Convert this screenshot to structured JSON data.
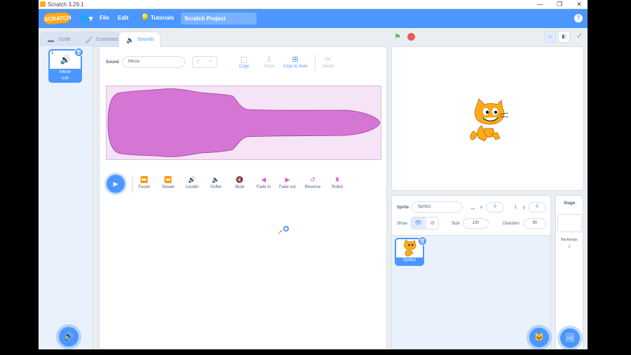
{
  "window": {
    "title": "Scratch 3.29.1",
    "controls": [
      "—",
      "❐",
      "✕"
    ]
  },
  "menubar": {
    "logo": "SCRATCH",
    "language_icon": "globe-icon",
    "file": "File",
    "edit": "Edit",
    "tutorials": "Tutorials",
    "project_title": "Scratch Project",
    "help": "?"
  },
  "tabs": [
    {
      "label": "Code",
      "icon": "code-icon"
    },
    {
      "label": "Costumes",
      "icon": "brush-icon"
    },
    {
      "label": "Sounds",
      "icon": "speaker-icon"
    }
  ],
  "soundlist": {
    "items": [
      {
        "number": "1",
        "name": "Meow",
        "duration": "0.85"
      }
    ]
  },
  "editor": {
    "sound_label": "Sound",
    "sound_name": "Meow",
    "tools": [
      {
        "label": "Copy",
        "enabled": true
      },
      {
        "label": "Paste",
        "enabled": false
      },
      {
        "label": "Copy to New",
        "enabled": true
      },
      {
        "label": "Delete",
        "enabled": false
      }
    ],
    "effects": [
      "Faster",
      "Slower",
      "Louder",
      "Softer",
      "Mute",
      "Fade in",
      "Fade out",
      "Reverse",
      "Robot"
    ],
    "waveform_color": "#cf63cf"
  },
  "sprite_info": {
    "sprite_label": "Sprite",
    "sprite_name": "Sprite1",
    "x_label": "x",
    "x": "0",
    "y_label": "y",
    "y": "0",
    "show_label": "Show",
    "size_label": "Size",
    "size": "100",
    "direction_label": "Direction",
    "direction": "90"
  },
  "sprites": [
    {
      "name": "Sprite1"
    }
  ],
  "stage_pane": {
    "title": "Stage",
    "backdrops_label": "Backdrops",
    "backdrops_count": "1"
  },
  "colors": {
    "accent": "#4c97ff",
    "menubar": "#4c97ff",
    "sound_purple": "#cf63cf",
    "flag_green": "#4cbf56",
    "stop_red": "#ec5959"
  }
}
